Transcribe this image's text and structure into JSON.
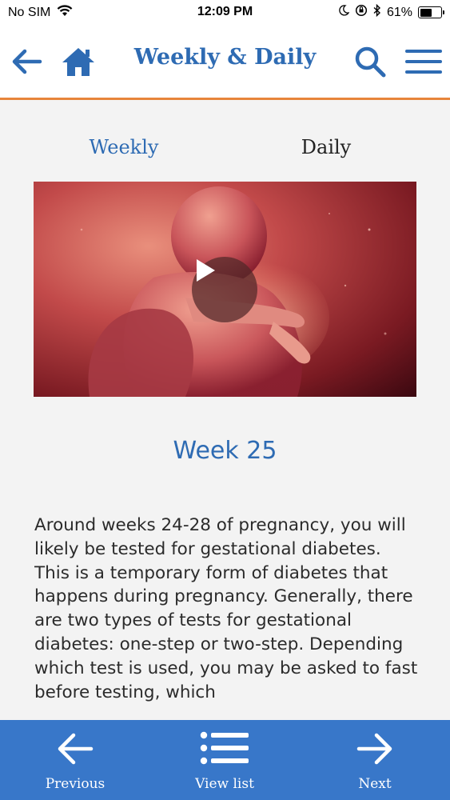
{
  "status_bar": {
    "carrier": "No SIM",
    "time": "12:09 PM",
    "battery": "61%",
    "battery_level": 0.61,
    "icons": [
      "wifi-icon",
      "moon-icon",
      "orientation-lock-icon",
      "bluetooth-icon",
      "battery-icon"
    ]
  },
  "header": {
    "title": "Weekly & Daily",
    "icons": [
      "back-arrow-icon",
      "home-icon",
      "search-icon",
      "menu-icon"
    ],
    "accent_color": "#2e6bb3",
    "border_color": "#e7853a"
  },
  "tabs": [
    {
      "label": "Weekly",
      "active": true
    },
    {
      "label": "Daily",
      "active": false
    }
  ],
  "video": {
    "icon": "play-icon"
  },
  "content": {
    "week_title": "Week 25",
    "body": "Around weeks 24-28 of pregnancy, you will likely be tested for gestational diabetes. This is a temporary form of diabetes that happens during pregnancy. Generally, there are two types of tests for gestational diabetes: one-step or two-step. Depending which test is used, you may be asked to fast before testing, which"
  },
  "bottom_nav": {
    "previous_label": "Previous",
    "view_list_label": "View list",
    "next_label": "Next",
    "background_color": "#3877c9"
  }
}
